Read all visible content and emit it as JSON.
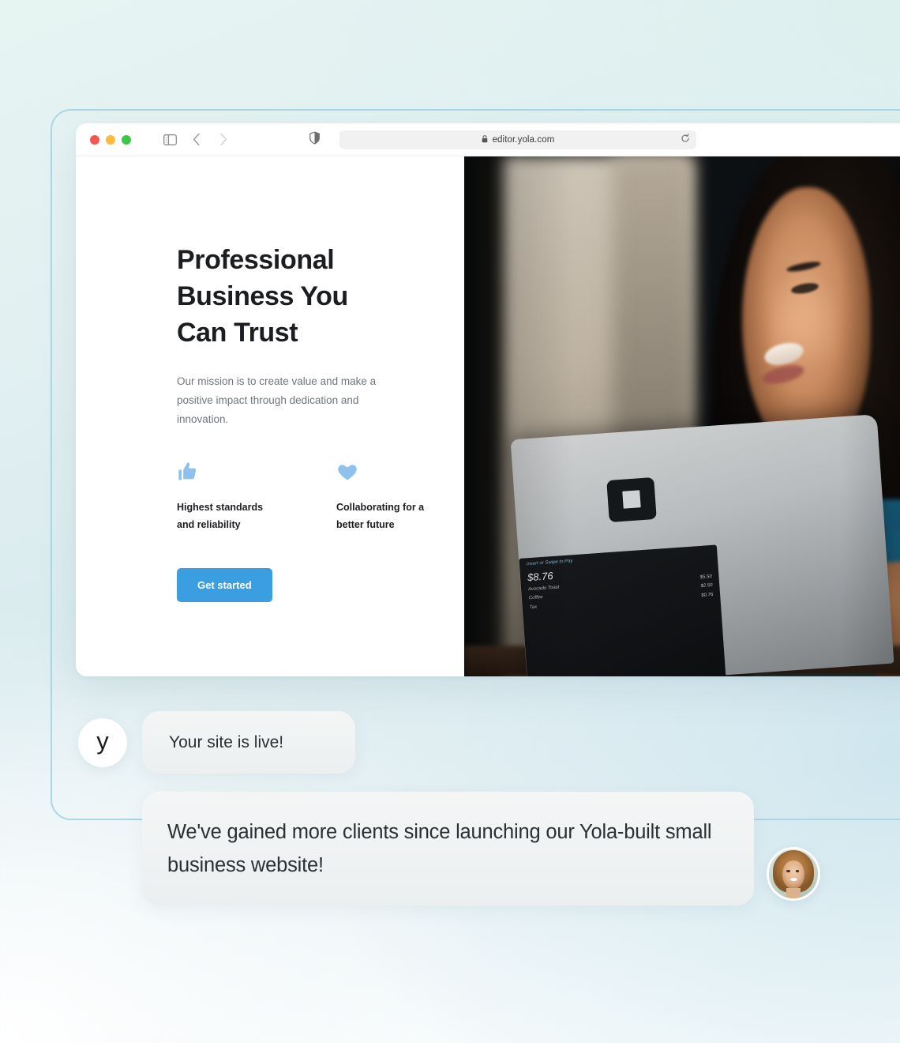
{
  "browser": {
    "url": "editor.yola.com",
    "lock_icon": "lock-icon",
    "reload_icon": "reload-icon",
    "sidebar_icon": "sidebar-toggle-icon",
    "back_icon": "chevron-left-icon",
    "forward_icon": "chevron-right-icon",
    "shield_icon": "shield-icon",
    "traffic_lights": [
      "close-red",
      "minimize-yellow",
      "maximize-green"
    ]
  },
  "hero": {
    "title": "Professional Business You Can Trust",
    "subtitle": "Our mission is to create value and make a positive impact through dedication and innovation.",
    "features": [
      {
        "icon": "thumbs-up-icon",
        "label": "Highest standards and reliability"
      },
      {
        "icon": "heart-icon",
        "label": "Collaborating for a better future"
      }
    ],
    "cta_label": "Get started"
  },
  "photo": {
    "pos_header": "Insert or Swipe to Pay",
    "pos_total": "$8.76",
    "pos_items": [
      {
        "name": "Avocado Toast",
        "price": "$5.50"
      },
      {
        "name": "Coffee",
        "price": "$2.50"
      },
      {
        "name": "Tax",
        "price": "$0.76"
      }
    ]
  },
  "chat": {
    "brand_initial": "y",
    "message_1": "Your site is live!",
    "message_2": "We've gained more clients since launching our Yola-built small business website!"
  },
  "colors": {
    "accent_blue": "#3b9ee0",
    "feature_icon_blue": "#8dc2ec",
    "frame_border": "#a9d7e8"
  }
}
